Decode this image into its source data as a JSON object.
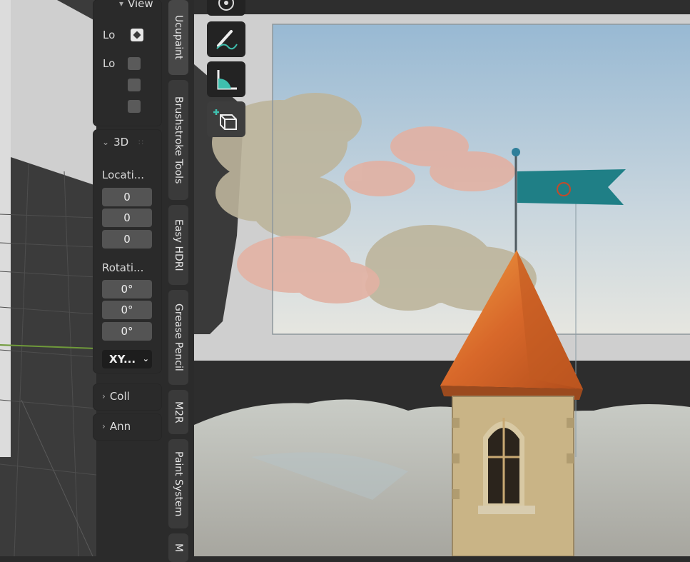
{
  "item_panel": {
    "view_header": "View",
    "lock_labels": [
      "Lo",
      "Lo"
    ]
  },
  "transform_panel": {
    "header": "3D",
    "location_label": "Locati...",
    "location": [
      "0",
      "0",
      "0"
    ],
    "rotation_label": "Rotati...",
    "rotation": [
      "0°",
      "0°",
      "0°"
    ],
    "rotation_mode": "XY..."
  },
  "collapsed_panels": [
    "Coll",
    "Ann"
  ],
  "sidebar_tabs": [
    "Ucupaint",
    "Brushstroke Tools",
    "Easy HDRI",
    "Grease Pencil",
    "M2R",
    "Paint System",
    "M"
  ],
  "tools": [
    "orbit-icon",
    "draw-icon",
    "measure-icon",
    "add-cube-icon"
  ],
  "colors": {
    "sky_top": "#9dbcd5",
    "flag": "#1f7f86",
    "roof": "#d8682a"
  }
}
